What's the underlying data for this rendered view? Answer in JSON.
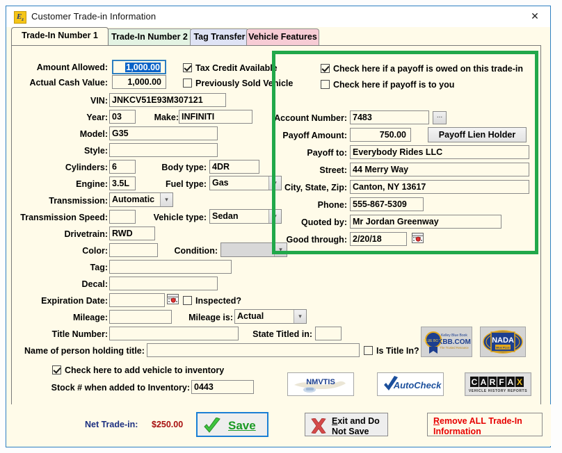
{
  "window": {
    "title": "Customer Trade-in Information",
    "icon": "ez-logo-icon",
    "close_label": "✕"
  },
  "tabs": [
    {
      "label": "Trade-In Number 1",
      "selected": true,
      "color": "#fffbe9"
    },
    {
      "label": "Trade-In Number 2",
      "selected": false,
      "color": "#e3f3e3"
    },
    {
      "label": "Tag Transfer",
      "selected": false,
      "color": "#dfe3f5"
    },
    {
      "label": "Vehicle Features",
      "selected": false,
      "color": "#f7ccd5"
    }
  ],
  "vehicle": {
    "amount_allowed_label": "Amount Allowed:",
    "amount_allowed_value": "1,000.00",
    "actual_cash_value_label": "Actual Cash Value:",
    "actual_cash_value_value": "1,000.00",
    "vin_label": "VIN:",
    "vin_value": "JNKCV51E93M307121",
    "year_label": "Year:",
    "year_value": "03",
    "make_label": "Make:",
    "make_value": "INFINITI",
    "model_label": "Model:",
    "model_value": "G35",
    "style_label": "Style:",
    "style_value": "",
    "cylinders_label": "Cylinders:",
    "cylinders_value": "6",
    "body_type_label": "Body type:",
    "body_type_value": "4DR",
    "engine_label": "Engine:",
    "engine_value": "3.5L",
    "fuel_type_label": "Fuel type:",
    "fuel_type_value": "Gas",
    "transmission_label": "Transmission:",
    "transmission_value": "Automatic",
    "transmission_speed_label": "Transmission Speed:",
    "transmission_speed_value": "",
    "vehicle_type_label": "Vehicle type:",
    "vehicle_type_value": "Sedan",
    "drivetrain_label": "Drivetrain:",
    "drivetrain_value": "RWD",
    "color_label": "Color:",
    "color_value": "",
    "condition_label": "Condition:",
    "condition_value": "",
    "tag_label": "Tag:",
    "tag_value": "",
    "decal_label": "Decal:",
    "decal_value": "",
    "expiration_date_label": "Expiration Date:",
    "expiration_date_value": "",
    "inspected_label": "Inspected?",
    "inspected_checked": false,
    "mileage_label": "Mileage:",
    "mileage_value": "",
    "mileage_is_label": "Mileage is:",
    "mileage_is_value": "Actual",
    "title_number_label": "Title Number:",
    "title_number_value": "",
    "state_titled_label": "State Titled in:",
    "state_titled_value": "",
    "name_holding_title_label": "Name of person holding title:",
    "name_holding_title_value": "",
    "is_title_in_label": "Is Title In?",
    "is_title_in_checked": false
  },
  "checkboxes": {
    "tax_credit_label": "Tax Credit Available",
    "tax_credit_checked": true,
    "prev_sold_label": "Previously Sold Vehicle",
    "prev_sold_checked": false,
    "add_inventory_label": "Check here to add vehicle to inventory",
    "add_inventory_checked": true
  },
  "inventory": {
    "stock_label": "Stock # when added to Inventory:",
    "stock_value": "0443"
  },
  "payoff": {
    "owed_label": "Check here if a payoff is owed on this trade-in",
    "owed_checked": true,
    "to_you_label": "Check here if payoff is to you",
    "to_you_checked": false,
    "account_number_label": "Account Number:",
    "account_number_value": "7483",
    "account_browse_label": "...",
    "payoff_amount_label": "Payoff Amount:",
    "payoff_amount_value": "750.00",
    "lien_holder_button": "Payoff Lien Holder",
    "payoff_to_label": "Payoff to:",
    "payoff_to_value": "Everybody Rides LLC",
    "street_label": "Street:",
    "street_value": "44 Merry Way",
    "city_state_zip_label": "City, State, Zip:",
    "city_state_zip_value": "Canton, NY 13617",
    "phone_label": "Phone:",
    "phone_value": "555-867-5309",
    "quoted_by_label": "Quoted by:",
    "quoted_by_value": "Mr Jordan Greenway",
    "good_through_label": "Good through:",
    "good_through_value": "2/20/18",
    "highlight_color": "#21a84a"
  },
  "logos": [
    {
      "name": "kbb-logo",
      "text": "KBB.COM"
    },
    {
      "name": "nada-logo",
      "text": "NADA"
    },
    {
      "name": "nmvtis-logo",
      "text": "NMVTIS"
    },
    {
      "name": "autocheck-logo",
      "text": "AutoCheck"
    },
    {
      "name": "carfax-logo",
      "text": "CARFAX"
    }
  ],
  "logo_sub": {
    "kbb_top": "Kelley Blue Book",
    "kbb_bottom": "The Trusted Resource",
    "nada_sub": "Blue PLus",
    "carfax_sub": "VEHICLE HISTORY REPORTS"
  },
  "footer": {
    "net_trade_label": "Net Trade-in:",
    "net_trade_value": "$250.00",
    "save_label": "Save",
    "exit_line1": "Exit and Do",
    "exit_line2": "Not Save",
    "remove_line1": "Remove ALL Trade-In",
    "remove_line2": "Information"
  }
}
